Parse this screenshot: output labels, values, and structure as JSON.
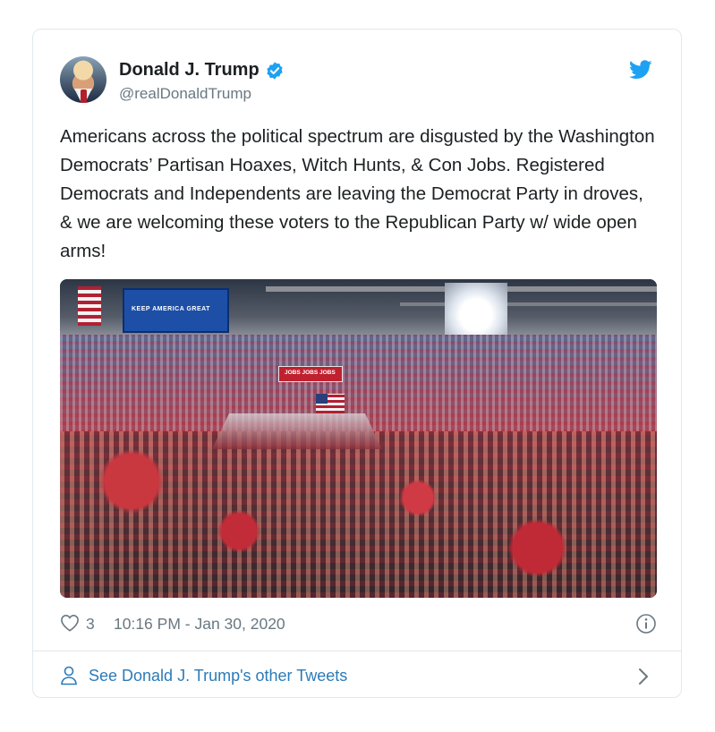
{
  "tweet": {
    "author": {
      "name": "Donald J. Trump",
      "handle": "@realDonaldTrump",
      "verified": true,
      "avatar_icon": "profile-photo"
    },
    "brand_icon": "twitter-bird-icon",
    "text": "Americans across the political spectrum are disgusted by the Washington Democrats’ Partisan Hoaxes, Witch Hunts, & Con Jobs. Registered Democrats and Independents are leaving the Democrat Party in droves, & we are welcoming these voters to the Republican Party w/ wide open arms!",
    "media": {
      "type": "photo",
      "screen_text": "KEEP AMERICA GREAT",
      "stage_sign_text": "JOBS JOBS JOBS"
    },
    "likes": "3",
    "timestamp": "10:16 PM - Jan 30, 2020",
    "more_tweets_label": "See Donald J. Trump's other Tweets"
  },
  "colors": {
    "link": "#2b7bb9",
    "twitter_blue": "#1da1f2",
    "muted_text": "#697882",
    "border": "#e1e8ed"
  }
}
